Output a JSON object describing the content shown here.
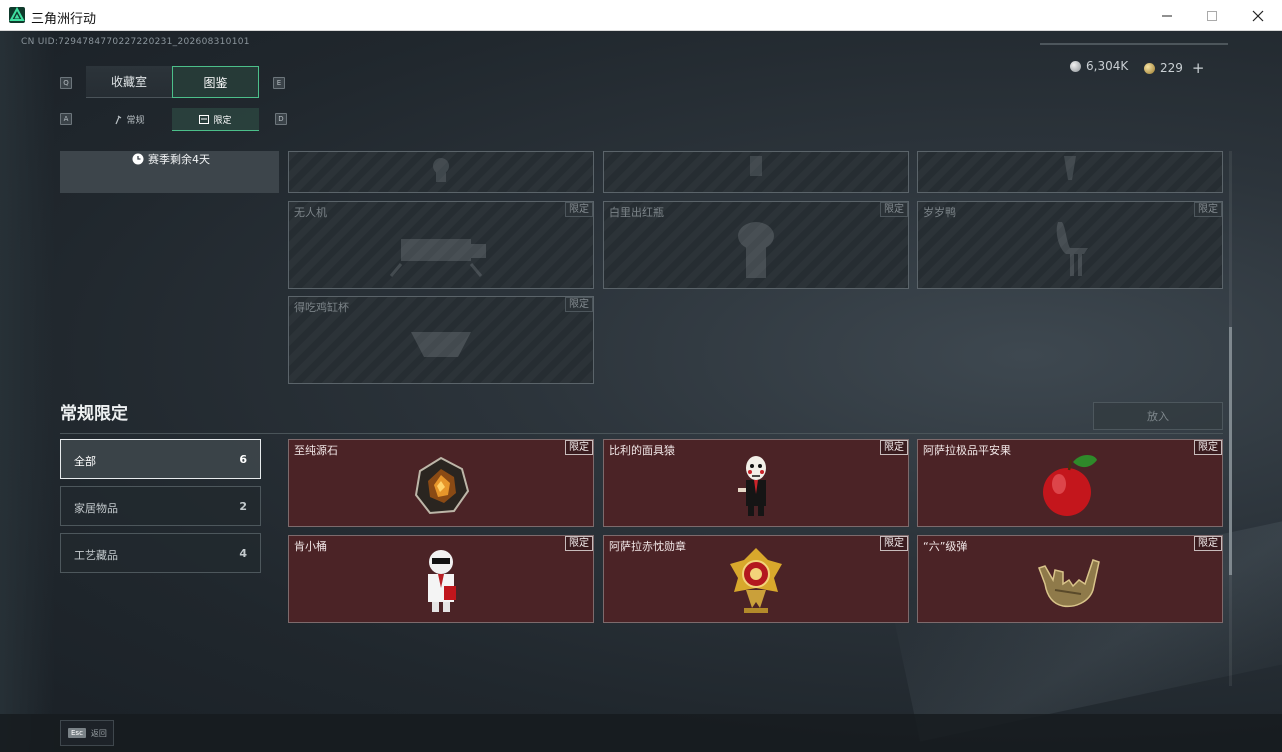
{
  "window": {
    "title": "三角洲行动",
    "controls": {
      "minimize": "minimize-icon",
      "maximize": "maximize-icon",
      "close": "close-icon"
    }
  },
  "header": {
    "uid": "CN UID:7294784770227220231_202608310101",
    "currency": [
      {
        "icon": "silver-coin-icon",
        "value": "6,304K"
      },
      {
        "icon": "gold-coin-icon",
        "value": "229"
      }
    ],
    "currency_add": "+"
  },
  "tabs": {
    "key_prev": "Q",
    "key_next": "E",
    "items": [
      {
        "label": "收藏室",
        "active": false
      },
      {
        "label": "图鉴",
        "active": true
      }
    ]
  },
  "subtabs": {
    "key_prev": "A",
    "key_next": "D",
    "items": [
      {
        "label": "常规",
        "icon": "wrench-icon",
        "active": false
      },
      {
        "label": "限定",
        "icon": "card-icon",
        "active": true
      }
    ]
  },
  "season": {
    "text": "赛季剩余4天",
    "icon": "clock-icon"
  },
  "locked_cards": [
    {
      "name": "",
      "badge": ""
    },
    {
      "name": "",
      "badge": ""
    },
    {
      "name": "",
      "badge": ""
    },
    {
      "name": "无人机",
      "badge": "限定"
    },
    {
      "name": "白里出红瓶",
      "badge": "限定"
    },
    {
      "name": "岁岁鸭",
      "badge": "限定"
    },
    {
      "name": "得吃鸡缸杯",
      "badge": "限定"
    }
  ],
  "section": {
    "title": "常规限定",
    "put_button": "放入",
    "filters": [
      {
        "label": "全部",
        "count": "6",
        "active": true
      },
      {
        "label": "家居物品",
        "count": "2",
        "active": false
      },
      {
        "label": "工艺藏品",
        "count": "4",
        "active": false
      }
    ]
  },
  "owned_cards": [
    {
      "name": "至纯源石",
      "badge": "限定",
      "art": "gem-stone-art"
    },
    {
      "name": "比利的面具猿",
      "badge": "限定",
      "art": "puppet-figure-art"
    },
    {
      "name": "阿萨拉极品平安果",
      "badge": "限定",
      "art": "red-apple-art"
    },
    {
      "name": "肯小桶",
      "badge": "限定",
      "art": "colonel-figure-art"
    },
    {
      "name": "阿萨拉赤忱勋章",
      "badge": "限定",
      "art": "medal-art"
    },
    {
      "name": "“六”级弹",
      "badge": "限定",
      "art": "golden-hand-art"
    }
  ],
  "footer": {
    "key": "Esc",
    "label": "返回"
  },
  "colors": {
    "accent_green": "#4cbf8a",
    "owned_card_bg": "#4b2326",
    "page_bg": "#20272d"
  }
}
